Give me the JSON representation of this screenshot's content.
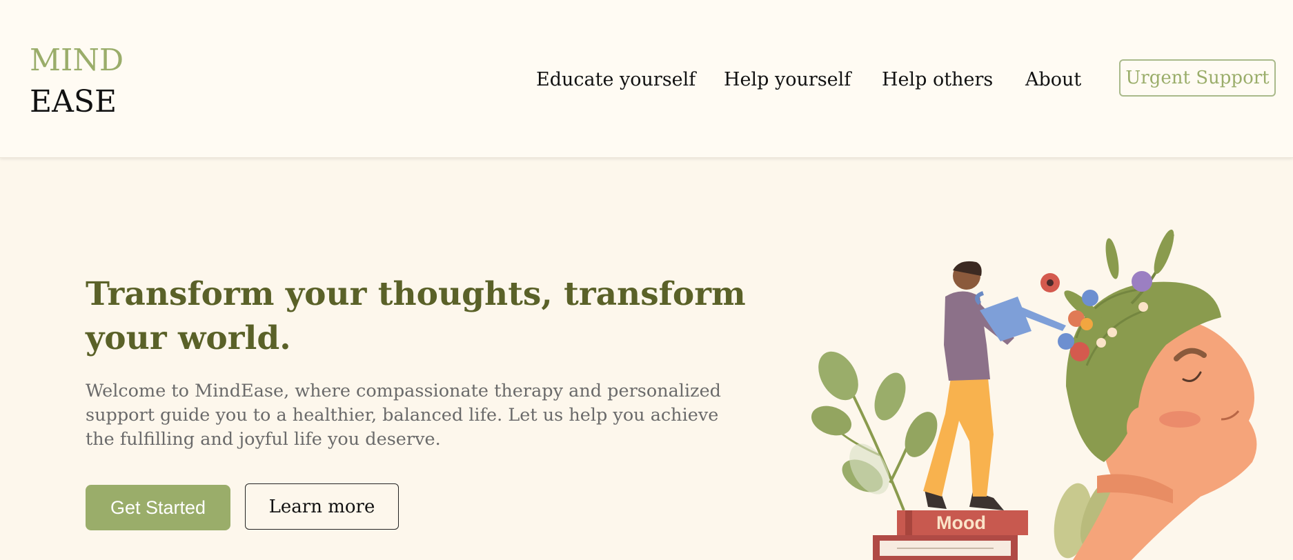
{
  "brand": {
    "line1": "MIND",
    "line2": "EASE"
  },
  "nav": {
    "items": [
      "Educate yourself",
      "Help yourself",
      "Help others",
      "About"
    ],
    "urgent_label": "Urgent Support"
  },
  "hero": {
    "title": "Transform your thoughts, transform your world.",
    "text": "Welcome to MindEase, where compassionate therapy and personalized support guide you to a healthier, balanced life. Let us help you achieve the fulfilling and joyful life you deserve.",
    "primary_label": "Get Started",
    "secondary_label": "Learn more"
  },
  "illustration": {
    "book_label": "Mood"
  },
  "colors": {
    "background": "#fdf7ec",
    "header": "#fffbf3",
    "accent": "#9aad6a",
    "title": "#5a6128",
    "body_text": "#6a6a6a"
  }
}
